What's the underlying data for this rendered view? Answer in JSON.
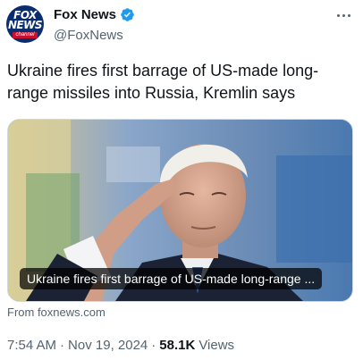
{
  "author": {
    "display_name": "Fox News",
    "handle": "@FoxNews",
    "verified": true,
    "avatar": {
      "line1": "FOX",
      "line2": "NEWS",
      "strip": "channel",
      "bg_color": "#0a2d6e",
      "strip_color": "#c8102e"
    }
  },
  "more_icon": "more-horizontal-icon",
  "tweet": {
    "text": "Ukraine fires first barrage of US-made long-range missiles into Russia, Kremlin says"
  },
  "media": {
    "overlay_caption": "Ukraine fires first barrage of US-made long-range ...",
    "source": "From foxnews.com"
  },
  "meta": {
    "time": "7:54 AM",
    "date": "Nov 19, 2024",
    "separator": "·",
    "views_count": "58.1K",
    "views_label": "Views"
  },
  "colors": {
    "text_primary": "#0f1419",
    "text_secondary": "#536471",
    "verified_blue": "#1d9bf0"
  }
}
